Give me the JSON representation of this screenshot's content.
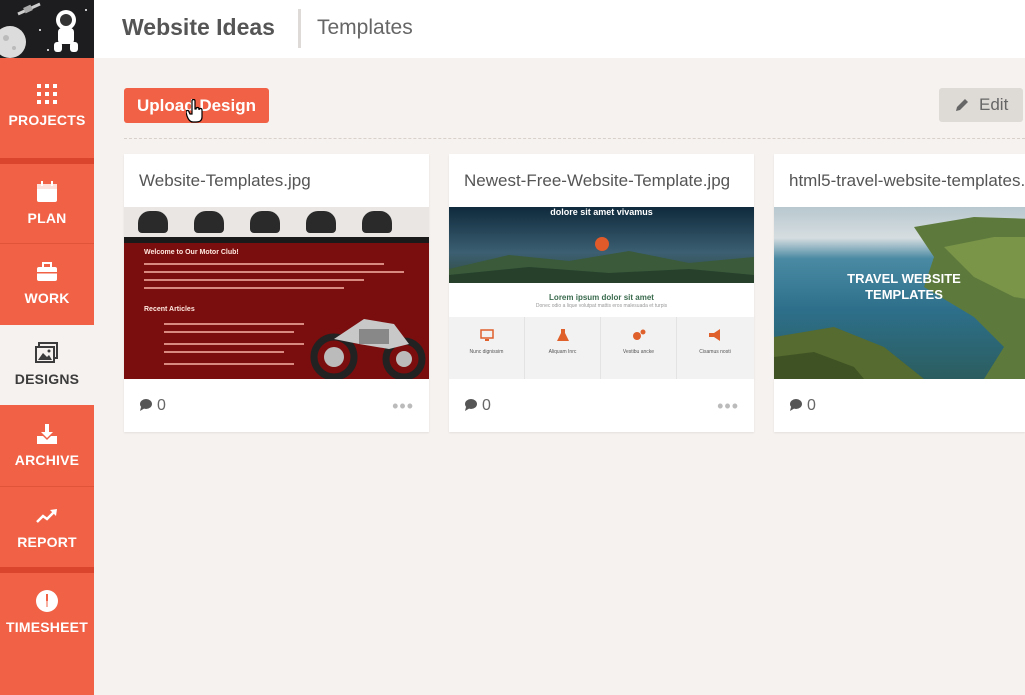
{
  "header": {
    "title": "Website Ideas",
    "subtitle": "Templates"
  },
  "sidebar": {
    "items": [
      {
        "key": "projects",
        "label": "PROJECTS",
        "icon": "grid-icon"
      },
      {
        "key": "plan",
        "label": "PLAN",
        "icon": "calendar-icon"
      },
      {
        "key": "work",
        "label": "WORK",
        "icon": "briefcase-icon"
      },
      {
        "key": "designs",
        "label": "DESIGNS",
        "icon": "images-icon",
        "active": true
      },
      {
        "key": "archive",
        "label": "ARCHIVE",
        "icon": "download-icon"
      },
      {
        "key": "report",
        "label": "REPORT",
        "icon": "trend-icon"
      },
      {
        "key": "timesheet",
        "label": "TIMESHEET",
        "icon": "clock-icon"
      }
    ]
  },
  "toolbar": {
    "upload_label": "Upload Design",
    "edit_label": "Edit"
  },
  "cards": [
    {
      "title": "Website-Templates.jpg",
      "comments": "0"
    },
    {
      "title": "Newest-Free-Website-Template.jpg",
      "comments": "0"
    },
    {
      "title": "html5-travel-website-templates.",
      "comments": "0"
    }
  ],
  "thumb1": {
    "welcome": "Welcome to Our Motor Club!",
    "recent": "Recent Articles"
  },
  "thumb2": {
    "hero": "dolore sit amet vivamus",
    "heading": "Lorem ipsum dolor sit amet",
    "small": "Donec odio a lique volutpat mattis eros malesuada et turpis",
    "cols": [
      "Nunc dignissim",
      "Aliquam Inrc",
      "Vestibu ancke",
      "Cisamus nosti"
    ]
  },
  "thumb3": {
    "line1": "TRAVEL WEBSITE",
    "line2": "TEMPLATES"
  },
  "colors": {
    "accent": "#f06145",
    "sidebar_dark": "#d9462d",
    "background": "#f6f2ef"
  }
}
